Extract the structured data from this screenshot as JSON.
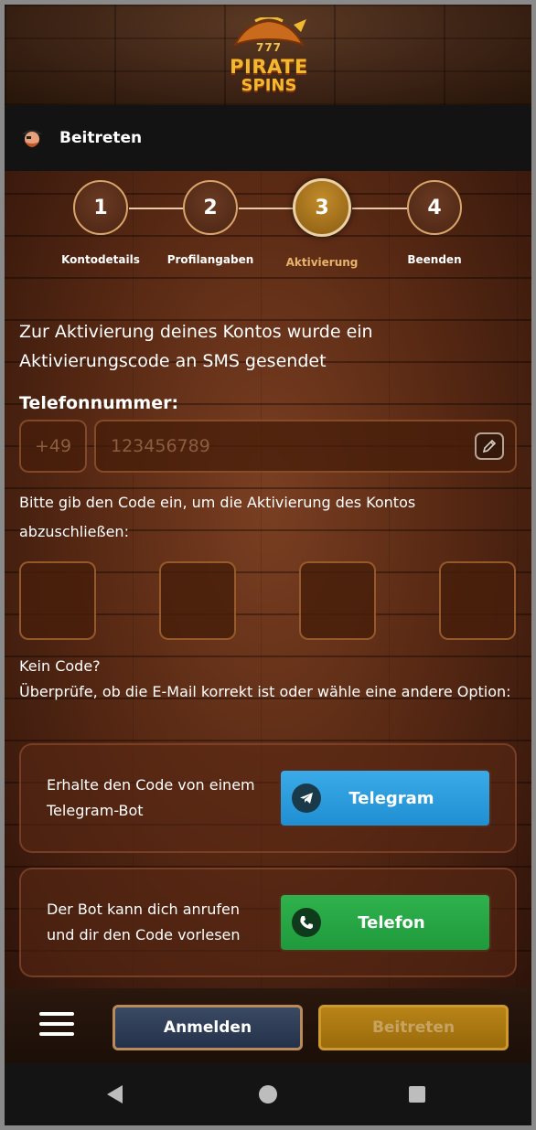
{
  "header": {
    "logo_top": "777",
    "logo_line1": "PIRATE",
    "logo_line2": "SPINS"
  },
  "titlebar": {
    "title": "Beitreten"
  },
  "steps": [
    {
      "number": "1",
      "label": "Kontodetails"
    },
    {
      "number": "2",
      "label": "Profilangaben"
    },
    {
      "number": "3",
      "label": "Aktivierung"
    },
    {
      "number": "4",
      "label": "Beenden"
    }
  ],
  "active_step": 3,
  "activation": {
    "info": "Zur Aktivierung deines Kontos wurde ein Aktivierungscode an SMS gesendet",
    "phone_label": "Telefonnummer:",
    "country_code_placeholder": "+49",
    "phone_placeholder": "123456789",
    "prompt": "Bitte gib den Code ein, um die Aktivierung des Kontos abzuschließen:",
    "no_code_line1": "Kein Code?",
    "no_code_line2": "Überprüfe, ob die E-Mail korrekt ist oder wähle eine andere Option:"
  },
  "options": [
    {
      "text": "Erhalte den Code von einem Telegram-Bot",
      "button": "Telegram",
      "icon": "telegram-icon"
    },
    {
      "text": "Der Bot kann dich anrufen und dir den Code vorlesen",
      "button": "Telefon",
      "icon": "phone-icon"
    }
  ],
  "bottom": {
    "login": "Anmelden",
    "join": "Beitreten"
  },
  "colors": {
    "accent_gold": "#e6b46a",
    "telegram_blue": "#2a9fe0",
    "phone_green": "#27a846"
  }
}
